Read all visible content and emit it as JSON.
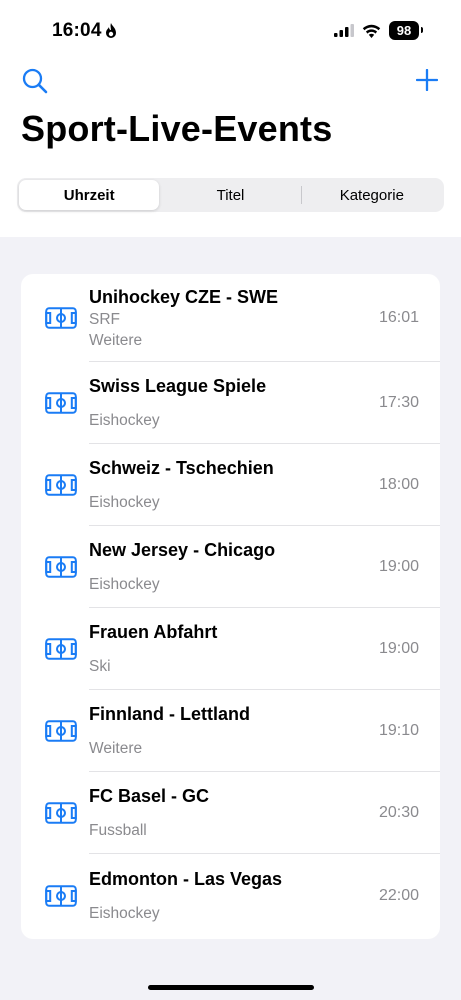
{
  "status_bar": {
    "time": "16:04",
    "battery": "98"
  },
  "nav": {
    "title": "Sport-Live-Events"
  },
  "segments": [
    {
      "label": "Uhrzeit",
      "active": true
    },
    {
      "label": "Titel",
      "active": false
    },
    {
      "label": "Kategorie",
      "active": false
    }
  ],
  "accent_color": "#1a7cf5",
  "events": [
    {
      "title": "Unihockey CZE - SWE",
      "channel": "SRF",
      "category": "Weitere",
      "time": "16:01"
    },
    {
      "title": "Swiss League Spiele",
      "channel": "",
      "category": "Eishockey",
      "time": "17:30"
    },
    {
      "title": "Schweiz - Tschechien",
      "channel": "",
      "category": "Eishockey",
      "time": "18:00"
    },
    {
      "title": "New Jersey - Chicago",
      "channel": "",
      "category": "Eishockey",
      "time": "19:00"
    },
    {
      "title": "Frauen Abfahrt",
      "channel": "",
      "category": "Ski",
      "time": "19:00"
    },
    {
      "title": "Finnland - Lettland",
      "channel": "",
      "category": "Weitere",
      "time": "19:10"
    },
    {
      "title": "FC Basel - GC",
      "channel": "",
      "category": "Fussball",
      "time": "20:30"
    },
    {
      "title": "Edmonton - Las Vegas",
      "channel": "",
      "category": "Eishockey",
      "time": "22:00"
    }
  ]
}
